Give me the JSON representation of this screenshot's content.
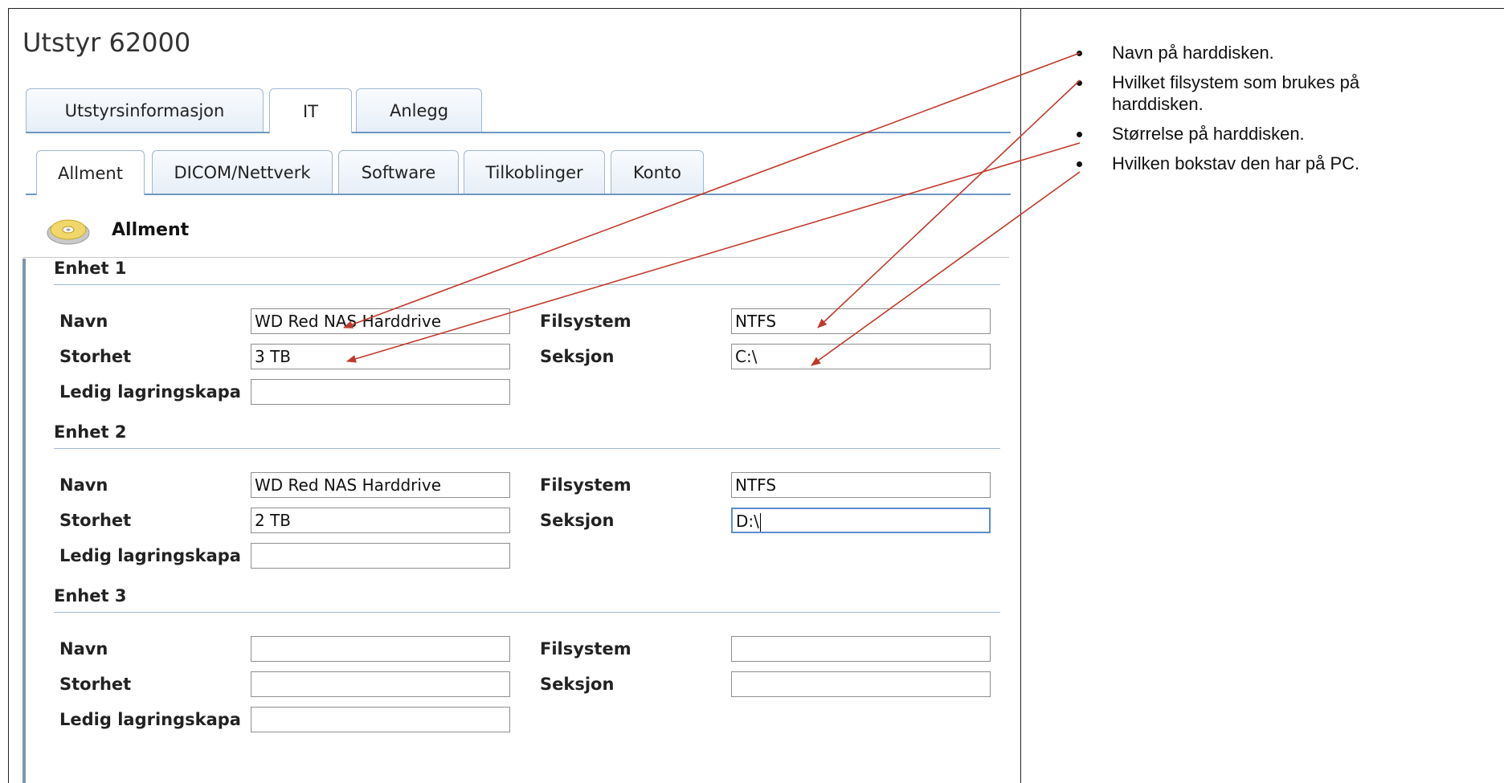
{
  "page_title": "Utstyr 62000",
  "tabs_top": [
    {
      "label": "Utstyrsinformasjon",
      "active": false
    },
    {
      "label": "IT",
      "active": true
    },
    {
      "label": "Anlegg",
      "active": false
    }
  ],
  "tabs_sub": [
    {
      "label": "Allment",
      "active": true
    },
    {
      "label": "DICOM/Nettverk",
      "active": false
    },
    {
      "label": "Software",
      "active": false
    },
    {
      "label": "Tilkoblinger",
      "active": false
    },
    {
      "label": "Konto",
      "active": false
    }
  ],
  "section": {
    "title": "Allment",
    "icon": "disk-icon"
  },
  "field_labels": {
    "navn": "Navn",
    "storhet": "Storhet",
    "ledig": "Ledig lagringskapa",
    "filsystem": "Filsystem",
    "seksjon": "Seksjon"
  },
  "units": [
    {
      "title": "Enhet 1",
      "navn": "WD Red NAS Harddrive",
      "storhet": "3 TB",
      "ledig": "",
      "filsystem": "NTFS",
      "seksjon": "C:\\"
    },
    {
      "title": "Enhet 2",
      "navn": "WD Red  NAS Harddrive",
      "storhet": "2 TB",
      "ledig": "",
      "filsystem": "NTFS",
      "seksjon": "D:\\",
      "seksjon_focused": true
    },
    {
      "title": "Enhet 3",
      "navn": "",
      "storhet": "",
      "ledig": "",
      "filsystem": "",
      "seksjon": ""
    }
  ],
  "notes": [
    "Navn på harddisken.",
    "Hvilket filsystem som brukes på harddisken.",
    "Størrelse på harddisken.",
    "Hvilken bokstav den har på PC."
  ],
  "colors": {
    "arrow": "#c0392b",
    "tab_border": "#9fb8d3",
    "focus": "#5b8ed0"
  }
}
